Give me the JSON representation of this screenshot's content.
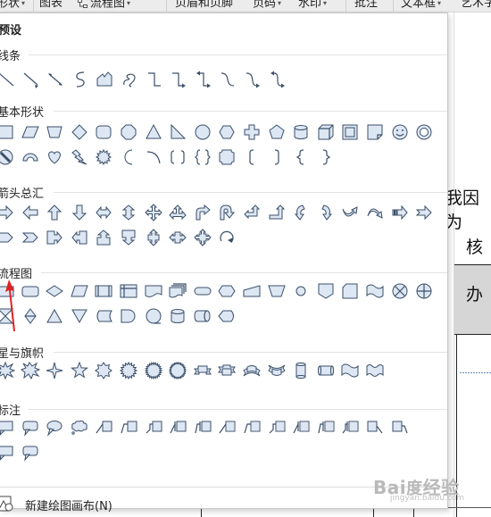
{
  "toolbar": {
    "items": [
      {
        "id": "shapes",
        "label": "形状",
        "has_arrow": true
      },
      {
        "id": "chart",
        "label": "图表",
        "has_arrow": false
      },
      {
        "id": "flowchart",
        "label": "流程图",
        "has_arrow": true
      },
      {
        "id": "header_footer",
        "label": "页眉和页脚",
        "has_arrow": false
      },
      {
        "id": "page_number",
        "label": "页码",
        "has_arrow": true
      },
      {
        "id": "watermark",
        "label": "水印",
        "has_arrow": true
      },
      {
        "id": "comment",
        "label": "批注",
        "has_arrow": false
      },
      {
        "id": "textbox",
        "label": "文本框",
        "has_arrow": true
      },
      {
        "id": "wordart",
        "label": "艺术字",
        "has_arrow": false
      }
    ],
    "arrow_glyph": "▾"
  },
  "panel": {
    "header": "预设",
    "sections": [
      {
        "id": "lines",
        "title": "线条"
      },
      {
        "id": "basic",
        "title": "基本形状"
      },
      {
        "id": "arrows",
        "title": "箭头总汇"
      },
      {
        "id": "flow",
        "title": "流程图"
      },
      {
        "id": "stars",
        "title": "星与旗帜"
      },
      {
        "id": "callouts",
        "title": "标注"
      }
    ],
    "footer": {
      "label": "新建绘图画布(N)",
      "icon": "new-canvas-icon"
    }
  },
  "document": {
    "cell_texts": [
      "我因为",
      "核",
      "办"
    ]
  },
  "watermark": {
    "text": "Bai度经验",
    "sub": "jingyan.baidu.com"
  },
  "colors": {
    "shape_fill": "#dde7f3",
    "shape_stroke": "#3b4f6a",
    "toolbar_bg": "#ececec",
    "pointer_red": "#e02020",
    "table_gray": "#d6d6d6"
  }
}
